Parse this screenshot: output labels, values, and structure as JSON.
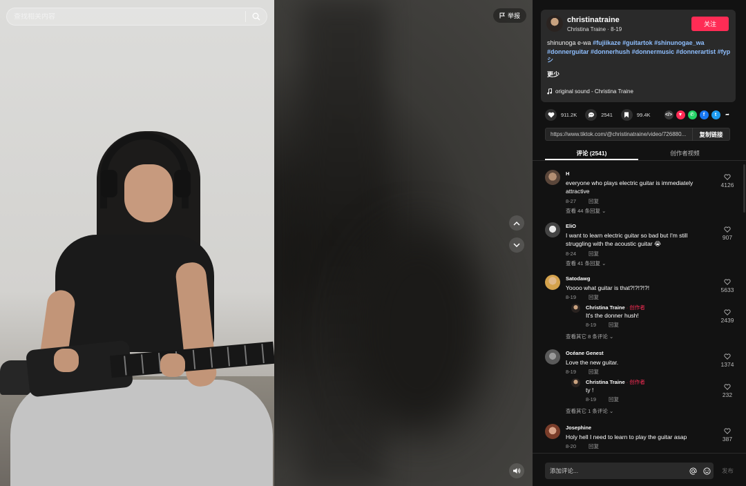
{
  "search": {
    "placeholder": "查找相关内容"
  },
  "report": {
    "label": "举报"
  },
  "author": {
    "username": "christinatraine",
    "display": "Christina Traine",
    "date": "8-19",
    "follow_label": "关注"
  },
  "description": {
    "text": "shinunoga e-wa",
    "tags": [
      "#fujiikaze",
      "#guitartok",
      "#shinunogae_wa",
      "#donnerguitar",
      "#donnerhush",
      "#donnermusic",
      "#donnerartist",
      "#fypシ"
    ],
    "more_label": "更少",
    "sound": "original sound - Christina Traine"
  },
  "stats": {
    "likes": "911.2K",
    "comments": "2541",
    "saves": "99.4K"
  },
  "share_icons": [
    "embed-icon",
    "repost-icon",
    "whatsapp-icon",
    "facebook-icon",
    "twitter-icon",
    "share-arrow-icon"
  ],
  "colors": {
    "accent": "#fe2c55",
    "hashtag": "#8fbfff"
  },
  "link": {
    "url": "https://www.tiktok.com/@christinatraine/video/726880...",
    "copy_label": "复制链接"
  },
  "tabs": [
    {
      "label": "评论 (2541)"
    },
    {
      "label": "创作者视频"
    }
  ],
  "comments": [
    {
      "name": "H",
      "text": "everyone who plays electric guitar is immediately attractive",
      "date": "8-27",
      "reply": "回复",
      "likes": "4126",
      "view": "查看 44 条回复"
    },
    {
      "name": "EliO",
      "text": "I want to learn electric guitar so bad but I'm still struggling with the acoustic guitar 😭",
      "date": "8-24",
      "reply": "回复",
      "likes": "907",
      "view": "查看 41 条回复"
    },
    {
      "name": "Satodawg",
      "text": "Yoooo what guitar is that?!?!?!?!",
      "date": "8-19",
      "reply": "回复",
      "likes": "5633",
      "view": "查看其它 8 条评论",
      "sub": {
        "name": "Christina Traine",
        "badge": "· 创作者",
        "text": "It's the donner hush!",
        "date": "8-19",
        "reply": "回复",
        "likes": "2439"
      }
    },
    {
      "name": "Océane Genest",
      "text": "Love the new guitar.",
      "date": "8-19",
      "reply": "回复",
      "likes": "1374",
      "view": "查看其它 1 条评论",
      "sub": {
        "name": "Christina Traine",
        "badge": "· 创作者",
        "text": "ty !",
        "date": "8-19",
        "reply": "回复",
        "likes": "232"
      }
    },
    {
      "name": "Josephine",
      "text": "Holy hell I need to learn to play the guitar asap",
      "date": "8-20",
      "reply": "回复",
      "likes": "387"
    }
  ],
  "comment_input": {
    "placeholder": "添加评论...",
    "post_label": "发布"
  }
}
